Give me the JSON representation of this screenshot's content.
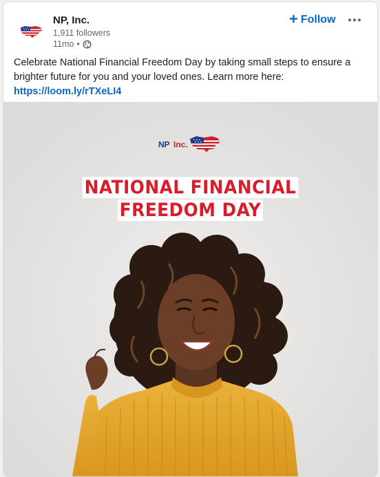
{
  "post": {
    "author": {
      "name": "NP, Inc.",
      "followers": "1,911 followers",
      "time": "11mo",
      "separator": "•",
      "logo_icon": "us-flag-map-icon",
      "visibility_icon": "globe-icon"
    },
    "follow_label": "Follow",
    "follow_icon": "plus-icon",
    "more_icon": "ellipsis-icon",
    "text": "Celebrate National Financial Freedom Day by taking small steps to ensure a brighter future for you and your loved ones. Learn more here:",
    "link": "https://loom.ly/rTXeLI4",
    "image": {
      "brand_np": "NP",
      "brand_inc": "Inc.",
      "headline_line1": "NATIONAL FINANCIAL",
      "headline_line2": "FREEDOM DAY",
      "subject": "smiling woman in yellow sweater"
    }
  },
  "colors": {
    "link_blue": "#0a66c2",
    "headline_red": "#d81e2c",
    "sweater_yellow": "#e3a32a",
    "image_bg": "#e6e5e3"
  }
}
